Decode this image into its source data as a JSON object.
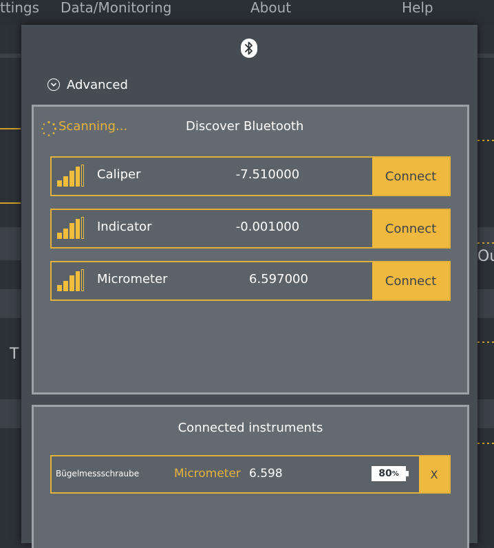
{
  "background": {
    "menu": [
      "ttings",
      "Data/Monitoring",
      "About",
      "Help"
    ],
    "fragments": [
      "Ou",
      "T"
    ]
  },
  "dialog": {
    "icon": "bluetooth-icon",
    "advanced_label": "Advanced",
    "discover": {
      "scanning_label": "Scanning...",
      "title": "Discover Bluetooth",
      "devices": [
        {
          "name": "Caliper",
          "value": "-7.510000",
          "action": "Connect",
          "signal_level": 3
        },
        {
          "name": "Indicator",
          "value": "-0.001000",
          "action": "Connect",
          "signal_level": 3
        },
        {
          "name": "Micrometer",
          "value": "6.597000",
          "action": "Connect",
          "signal_level": 3
        }
      ]
    },
    "connected": {
      "title": "Connected instruments",
      "instruments": [
        {
          "name": "Bügelmessschraube",
          "type": "Micrometer",
          "value": "6.598",
          "battery_value": "80",
          "battery_unit": "%",
          "remove_label": "X"
        }
      ]
    }
  },
  "colors": {
    "accent": "#efb940",
    "panel": "#646b70",
    "modal": "#454d53",
    "border": "#9ca2a6"
  }
}
